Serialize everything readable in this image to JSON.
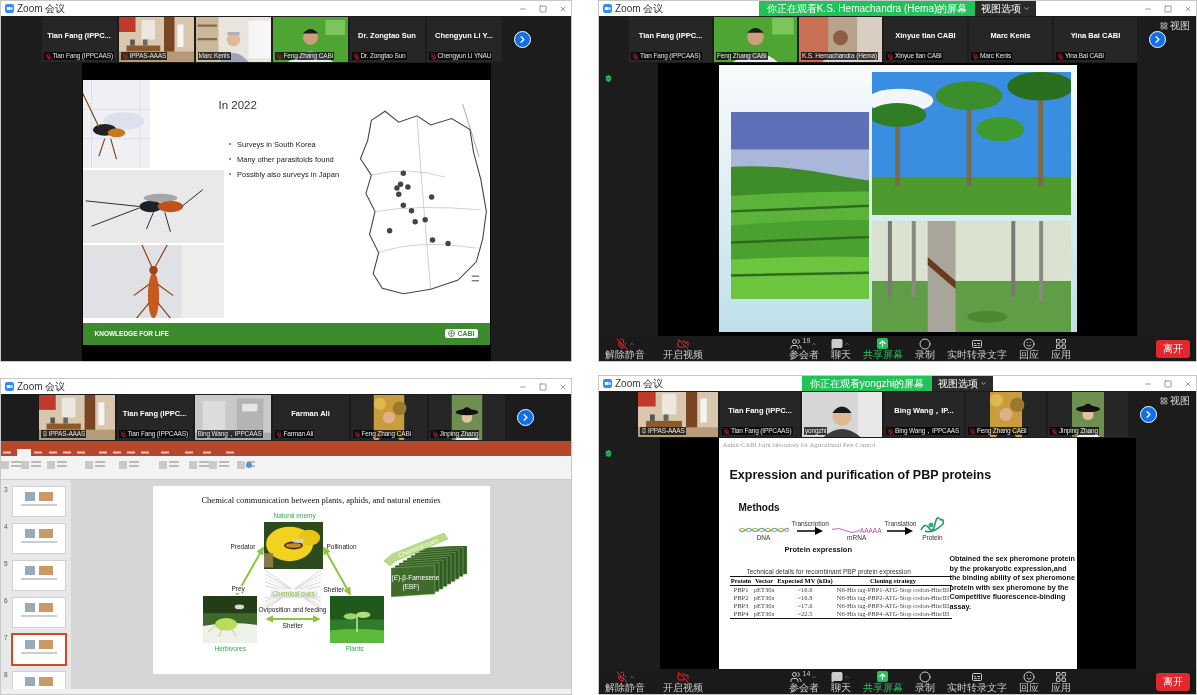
{
  "windows": [
    {
      "title": "Zoom 会议",
      "tiles": [
        {
          "kind": "name",
          "name": "Tian Fang (IPPC...",
          "label": "Tian Fang (IPPCAAS)",
          "muted": true,
          "pinned": false
        },
        {
          "kind": "video",
          "label": "IPPAS-AAAS",
          "muted": true,
          "pinned": false
        },
        {
          "kind": "video",
          "label": "Marc Kenis",
          "muted": false,
          "pinned": false
        },
        {
          "kind": "video",
          "label": "Feng Zhang CABI",
          "muted": true,
          "pinned": false
        },
        {
          "kind": "name",
          "name": "Dr. Zongtao Sun",
          "label": "Dr. Zongtao Sun",
          "muted": true,
          "pinned": false
        },
        {
          "kind": "name",
          "name": "Chengyun Li  Y...",
          "label": "Chengyun Li  YNAU",
          "muted": true,
          "pinned": false
        }
      ],
      "content": {
        "kind": "map",
        "title": "In 2022",
        "bullets": [
          "Surveys in South Korea",
          "Many other parasitoids found",
          "Possibly also surveys in Japan"
        ],
        "footer": "KNOWLEDGE FOR LIFE",
        "logo": "CABI"
      }
    },
    {
      "title": "Zoom 会议",
      "banner": "你正在观看K.S. Hemachandra (Hema)的屏幕",
      "banner_button": "视图选项",
      "view_button": "视图",
      "shield": true,
      "tiles": [
        {
          "kind": "name",
          "name": "Tian Fang (IPPC...",
          "label": "Tian Fang (IPPCAAS)",
          "muted": true,
          "pinned": false
        },
        {
          "kind": "video",
          "label": "Feng Zhang CABI",
          "muted": false,
          "pinned": false
        },
        {
          "kind": "video",
          "label": "K.S. Hemachandra (Hema)",
          "muted": false,
          "pinned": false
        },
        {
          "kind": "name",
          "name": "Xinyue tian CABI",
          "label": "Xinyue tian CABI",
          "muted": true,
          "pinned": false
        },
        {
          "kind": "name",
          "name": "Marc Kenis",
          "label": "Marc Kenis",
          "muted": true,
          "pinned": false
        },
        {
          "kind": "name",
          "name": "Yina Bai CABI",
          "label": "Yina Bai CABI",
          "muted": true,
          "pinned": false
        }
      ],
      "content": {
        "kind": "photos"
      },
      "toolbar": {
        "items": [
          {
            "kind": "mic",
            "label": "解除静音"
          },
          {
            "kind": "video",
            "label": "开启视频"
          },
          {
            "kind": "participants",
            "label": "参会者",
            "count": "19"
          },
          {
            "kind": "chat",
            "label": "聊天"
          },
          {
            "kind": "share",
            "label": "共享屏幕"
          },
          {
            "kind": "record",
            "label": "录制"
          },
          {
            "kind": "captions",
            "label": "实时转录文字"
          },
          {
            "kind": "reactions",
            "label": "回应"
          },
          {
            "kind": "apps",
            "label": "应用"
          }
        ],
        "leave": "离开"
      }
    },
    {
      "title": "Zoom 会议",
      "tiles": [
        {
          "kind": "video",
          "label": "IPPAS-AAAS",
          "muted": false,
          "pinned": true
        },
        {
          "kind": "name",
          "name": "Tian Fang (IPPC...",
          "label": "Tian Fang (IPPCAAS)",
          "muted": true,
          "pinned": false
        },
        {
          "kind": "video",
          "label": "Bing Wang，IPPCAAS",
          "muted": false,
          "pinned": false
        },
        {
          "kind": "name",
          "name": "Farman Ali",
          "label": "Farman Ali",
          "muted": true,
          "pinned": false
        },
        {
          "kind": "video",
          "label": "Feng Zhang CABI",
          "muted": true,
          "pinned": false
        },
        {
          "kind": "video",
          "label": "Jinping Zhang",
          "muted": true,
          "pinned": false
        }
      ],
      "content": {
        "kind": "ppt",
        "thumbnails": [
          {
            "number": "3",
            "selected": false
          },
          {
            "number": "4",
            "selected": false
          },
          {
            "number": "5",
            "selected": false
          },
          {
            "number": "6",
            "selected": false
          },
          {
            "number": "7",
            "selected": true
          },
          {
            "number": "8",
            "selected": false
          }
        ],
        "slide": {
          "title": "Chemical communication between plants, aphids, and natural enemies",
          "top": "Natural enemy",
          "left": "Herbivores",
          "right": "Plants",
          "predator": "Predator",
          "pollination": "Pollination",
          "prey": "Prey",
          "shelter_right": "Shelter",
          "center": "Chemical cues",
          "bottom": "Oviposition and feeding",
          "shelter_bottom": "Shelter",
          "cue_arrow": "Chemical cues",
          "compound": "(*E*)-β-Farnesene",
          "compound_abbr": "(EBF)"
        }
      }
    },
    {
      "title": "Zoom 会议",
      "banner": "你正在观看yongzhi的屏幕",
      "banner_button": "视图选项",
      "view_button": "视图",
      "shield": true,
      "tiles": [
        {
          "kind": "video",
          "label": "IPPAS-AAAS",
          "muted": false,
          "pinned": true
        },
        {
          "kind": "name",
          "name": "Tian Fang (IPPC...",
          "label": "Tian Fang (IPPCAAS)",
          "muted": true,
          "pinned": false
        },
        {
          "kind": "video",
          "label": "yongzhi",
          "muted": false,
          "pinned": false
        },
        {
          "kind": "name",
          "name": "Bing Wang，IP...",
          "label": "Bing Wang，IPPCAAS",
          "muted": true,
          "pinned": false
        },
        {
          "kind": "video",
          "label": "Feng Zhang CABI",
          "muted": true,
          "pinned": false
        },
        {
          "kind": "video",
          "label": "Jinping Zhang",
          "muted": true,
          "pinned": false
        }
      ],
      "content": {
        "kind": "pbp",
        "header": "Anhui-CABI Joint laboratory for Agricultural Pest Control",
        "title": "Expression and purification of PBP proteins",
        "methods": "Methods",
        "transcription": "Transcription",
        "translation": "Translation",
        "dna": "DNA",
        "mrna": "mRNA",
        "polya": "AAAAA",
        "protein": "Protein",
        "expression": "Protein expression",
        "paragraph": "Obtained the sex pheromone protein by the prokaryotic expression,and the binding ability of sex pheromone protein with sex pheromone by the Competitive fluorescence-binding assay.",
        "table": {
          "caption": "Technical details for recombinant PBP protein expression",
          "columns": [
            "Protein",
            "Vector",
            "Expected MV (kDa)",
            "Cloning strategy"
          ],
          "rows": [
            [
              "PBP1",
              "pET30a",
              "~16.6",
              "N6-His tag-PBP1-ATG-Stop codon-Hin/III"
            ],
            [
              "PBP2",
              "pET30a",
              "~16.8",
              "N6-His tag-PBP2-ATG-Stop codon-Hin/III"
            ],
            [
              "PBP3",
              "pET30a",
              "~17.6",
              "N6-His tag-PBP3-ATG-Stop codon-Hin/III"
            ],
            [
              "PBP4",
              "pET30a",
              "~22.5",
              "N6-His tag-PBP4-ATG-Stop codon-Hin/III"
            ]
          ]
        }
      },
      "toolbar": {
        "items": [
          {
            "kind": "mic",
            "label": "解除静音"
          },
          {
            "kind": "video",
            "label": "开启视频"
          },
          {
            "kind": "participants",
            "label": "参会者",
            "count": "14"
          },
          {
            "kind": "chat",
            "label": "聊天"
          },
          {
            "kind": "share",
            "label": "共享屏幕"
          },
          {
            "kind": "record",
            "label": "录制"
          },
          {
            "kind": "captions",
            "label": "实时转录文字"
          },
          {
            "kind": "reactions",
            "label": "回应"
          },
          {
            "kind": "apps",
            "label": "应用"
          }
        ],
        "leave": "离开"
      }
    }
  ]
}
